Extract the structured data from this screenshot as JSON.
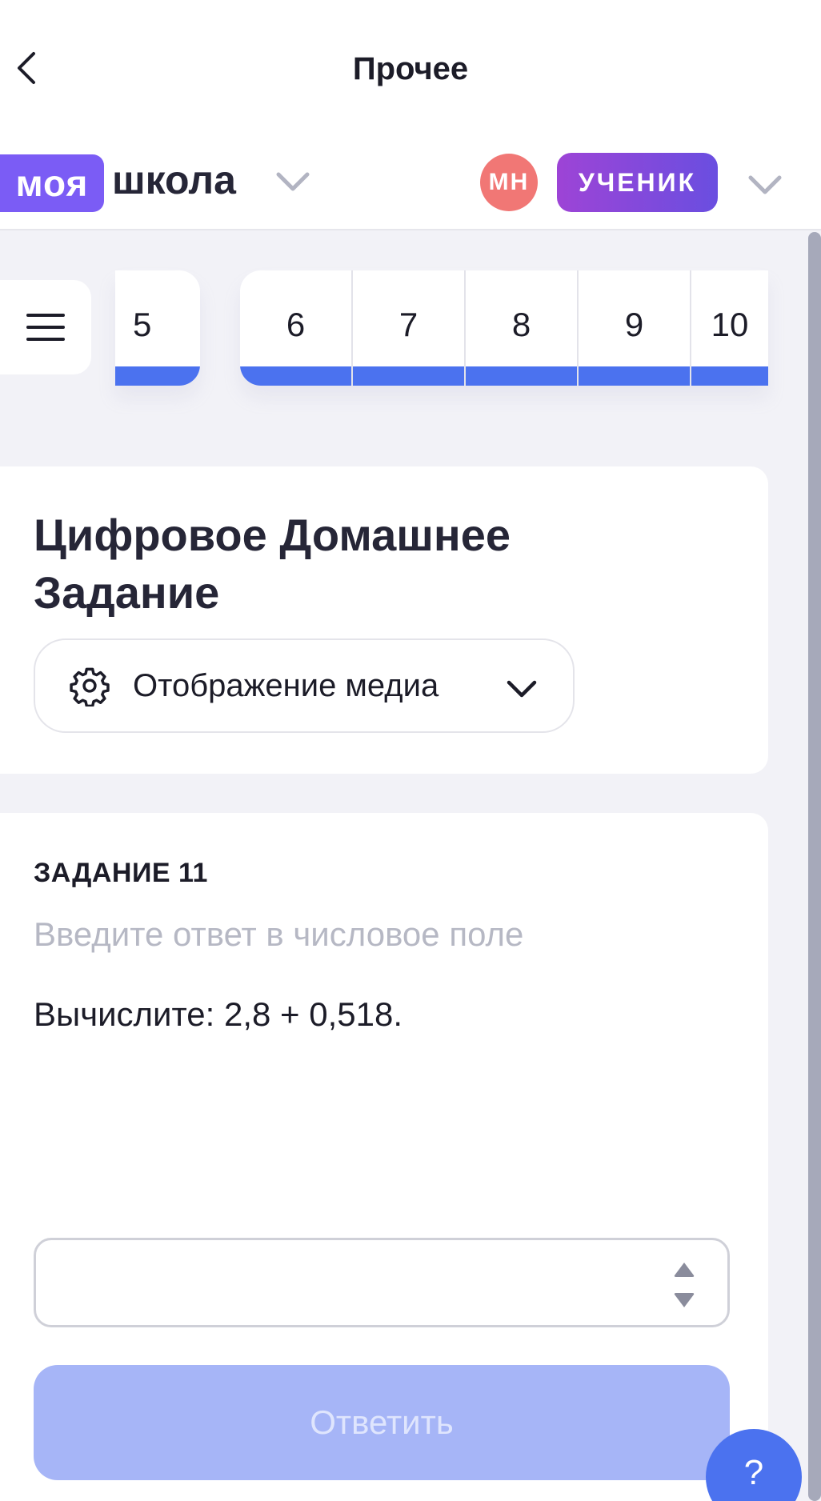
{
  "header": {
    "title": "Прочее",
    "logo_badge": "моя",
    "logo_text": "школа",
    "avatar_initials": "МН",
    "role": "УЧЕНИК"
  },
  "tabs": {
    "single": "5",
    "group": [
      "6",
      "7",
      "8",
      "9",
      "10"
    ]
  },
  "section": {
    "title": "Цифровое Домашнее Задание",
    "media_button": "Отображение медиа"
  },
  "task": {
    "label": "ЗАДАНИЕ 11",
    "hint": "Введите ответ в числовое поле",
    "question": "Вычислите: 2,8 + 0,518.",
    "answer_value": "",
    "submit_label": "Ответить"
  },
  "help": {
    "label": "?"
  },
  "colors": {
    "accent": "#4b72ef",
    "logo": "#7b5cf5",
    "avatar": "#f17775",
    "submit_disabled": "#a6b5f7"
  },
  "icons": [
    "back-arrow-icon",
    "chevron-down-icon",
    "hamburger-menu-icon",
    "gear-icon",
    "stepper-icon"
  ]
}
